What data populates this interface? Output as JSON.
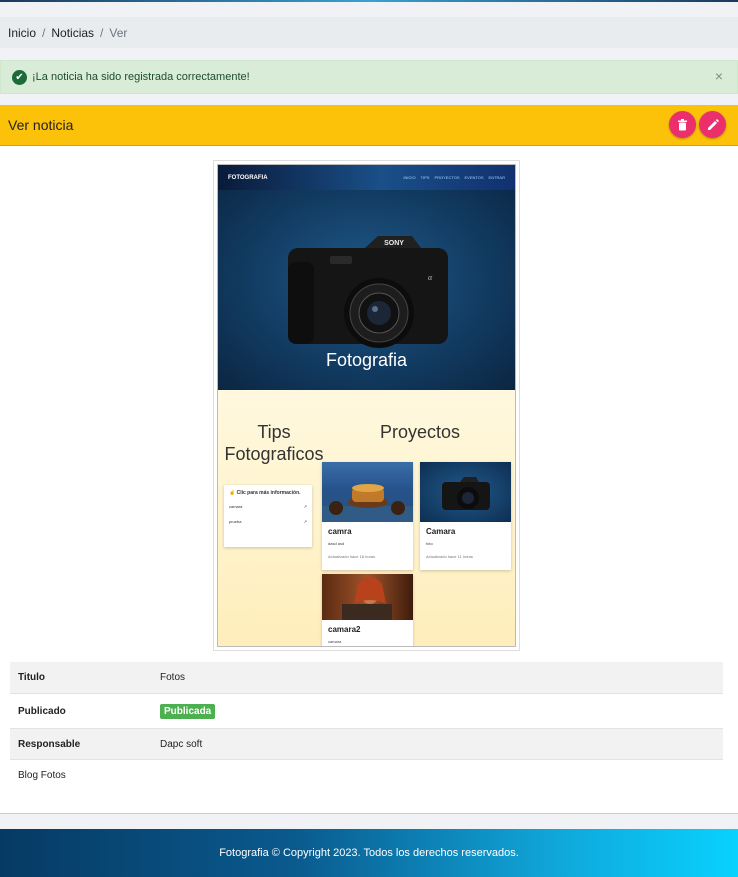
{
  "breadcrumb": {
    "home": "Inicio",
    "section": "Noticias",
    "current": "Ver",
    "separator": "/"
  },
  "alert": {
    "message": "¡La noticia ha sido registrada correctamente!",
    "close": "×",
    "icon": "check-circle-icon"
  },
  "card": {
    "title": "Ver noticia",
    "delete_icon": "trash-icon",
    "edit_icon": "pencil-icon",
    "accent": "#fcc109",
    "button_color": "#ea2f6c"
  },
  "preview": {
    "brand": "FOTOGRAFIA",
    "nav": [
      "INICIO",
      "TIPS",
      "PROYECTOS",
      "EVENTOS",
      "ENTRAR"
    ],
    "hero_title": "Fotografia",
    "tips_title": "Tips Fotograficos",
    "projects_title": "Proyectos",
    "tips_head": "Clic para más información.",
    "tips_items": [
      "camara",
      "prueba"
    ],
    "projects": [
      {
        "title": "camra",
        "desc": "dasd asd",
        "meta": "Actualizado hace 18 horas"
      },
      {
        "title": "Camara",
        "desc": "foto",
        "meta": "Actualizado hace 11 horas"
      },
      {
        "title": "camara2",
        "desc": "camara",
        "meta": ""
      }
    ]
  },
  "details": {
    "rows": [
      {
        "label": "Titulo",
        "value": "Fotos"
      },
      {
        "label": "Publicado",
        "value": "Publicada"
      },
      {
        "label": "Responsable",
        "value": "Dapc soft"
      }
    ],
    "description": "Blog Fotos",
    "badge_color": "#4caf50"
  },
  "footer": {
    "text": "Fotografia © Copyright 2023. Todos los derechos reservados."
  }
}
